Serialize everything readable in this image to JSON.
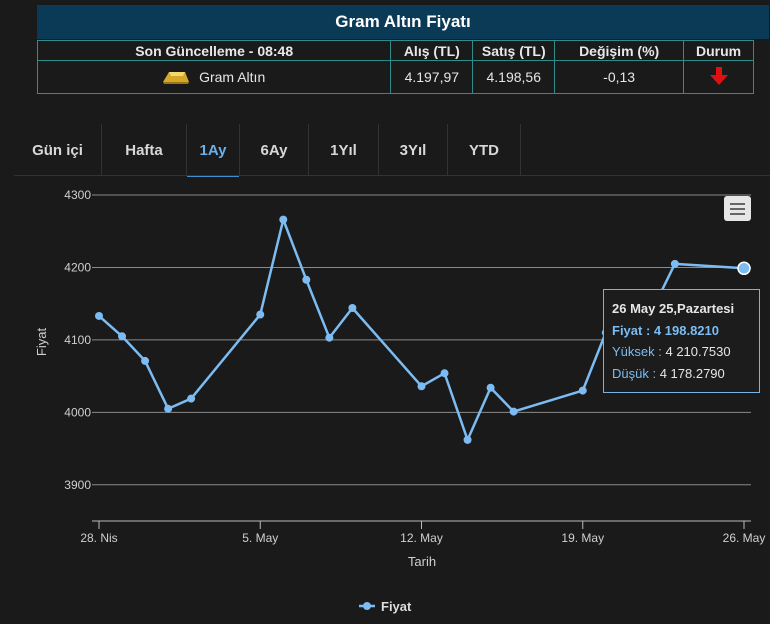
{
  "widget": {
    "title": "Gram Altın Fiyatı",
    "headers": [
      "Son Güncelleme - 08:48",
      "Alış (TL)",
      "Satış (TL)",
      "Değişim (%)",
      "Durum"
    ],
    "row": {
      "icon": "gold-bar-icon",
      "name": "Gram Altın",
      "buy": "4.197,97",
      "sell": "4.198,56",
      "change": "-0,13",
      "status_icon": "down-arrow-icon",
      "status_color": "#e01010"
    }
  },
  "tabs": [
    {
      "label": "Gün içi",
      "active": false
    },
    {
      "label": "Hafta",
      "active": false
    },
    {
      "label": "1Ay",
      "active": true
    },
    {
      "label": "6Ay",
      "active": false
    },
    {
      "label": "1Yıl",
      "active": false
    },
    {
      "label": "3Yıl",
      "active": false
    },
    {
      "label": "YTD",
      "active": false
    }
  ],
  "chart_data": {
    "type": "line",
    "xlabel": "Tarih",
    "ylabel": "Fiyat",
    "ylim": [
      3850,
      4300
    ],
    "yticks": [
      3900,
      4000,
      4100,
      4200,
      4300
    ],
    "xticks": [
      {
        "date": "2025-04-28",
        "label": "28. Nis"
      },
      {
        "date": "2025-05-05",
        "label": "5. May"
      },
      {
        "date": "2025-05-12",
        "label": "12. May"
      },
      {
        "date": "2025-05-19",
        "label": "19. May"
      },
      {
        "date": "2025-05-26",
        "label": "26. May"
      }
    ],
    "series": [
      {
        "name": "Fiyat",
        "color": "#7cbcf2",
        "points": [
          {
            "x": "2025-04-28",
            "y": 4133
          },
          {
            "x": "2025-04-29",
            "y": 4105
          },
          {
            "x": "2025-04-30",
            "y": 4071
          },
          {
            "x": "2025-05-01",
            "y": 4005
          },
          {
            "x": "2025-05-02",
            "y": 4019
          },
          {
            "x": "2025-05-05",
            "y": 4135
          },
          {
            "x": "2025-05-06",
            "y": 4266
          },
          {
            "x": "2025-05-07",
            "y": 4183
          },
          {
            "x": "2025-05-08",
            "y": 4103
          },
          {
            "x": "2025-05-09",
            "y": 4144
          },
          {
            "x": "2025-05-12",
            "y": 4036
          },
          {
            "x": "2025-05-13",
            "y": 4054
          },
          {
            "x": "2025-05-14",
            "y": 3962
          },
          {
            "x": "2025-05-15",
            "y": 4034
          },
          {
            "x": "2025-05-16",
            "y": 4001
          },
          {
            "x": "2025-05-19",
            "y": 4030
          },
          {
            "x": "2025-05-20",
            "y": 4110
          },
          {
            "x": "2025-05-21",
            "y": 4128
          },
          {
            "x": "2025-05-22",
            "y": 4140
          },
          {
            "x": "2025-05-23",
            "y": 4205
          },
          {
            "x": "2025-05-26",
            "y": 4198.821
          }
        ]
      }
    ],
    "legend": {
      "position": "bottom-center",
      "label": "Fiyat"
    },
    "tooltip": {
      "date": "26 May 25,Pazartesi",
      "price_key": "Fiyat :",
      "price_val": "4 198.8210",
      "high_key": "Yüksek :",
      "high_val": "4 210.7530",
      "low_key": "Düşük :",
      "low_val": "4 178.2790"
    },
    "menu_icon": "hamburger-menu-icon"
  }
}
